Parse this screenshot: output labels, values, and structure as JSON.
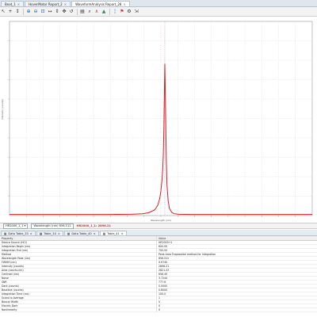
{
  "window_tabs": [
    {
      "label": "Beat_1",
      "active": false
    },
    {
      "label": "HoverMotor Report_2",
      "active": false
    },
    {
      "label": "WaveformAnalysis Report_28",
      "active": true
    }
  ],
  "toolbar_icons": [
    "cursor-icon",
    "crosshair-icon",
    "arrow-icon",
    "zoom-in-icon",
    "zoom-out-icon",
    "zoom-fit-icon",
    "zoom-x-icon",
    "zoom-y-icon",
    "pan-icon",
    "undo-icon",
    "print-icon",
    "find-icon",
    "peak-icon",
    "area-icon",
    "marker-icon",
    "flag-icon",
    "settings-icon",
    "export-icon"
  ],
  "statusbar": {
    "dataset": "HR2000_1_1",
    "readout": "Wavelength (nm) 656.512",
    "highlight": "HR2000_1_1: 2896.21"
  },
  "bottom_tabs": [
    {
      "label": "Data Table_33",
      "active": false
    },
    {
      "label": "Table_34",
      "active": false
    },
    {
      "label": "Data Table_40",
      "active": false
    },
    {
      "label": "Table_41",
      "active": true
    }
  ],
  "table": {
    "headers": [
      "Property",
      "Value"
    ],
    "rows": [
      [
        "Device Source (HCl)",
        "HR2000+1"
      ],
      [
        "Integration Begin (nm)",
        "600.00"
      ],
      [
        "Integration End (nm)",
        "700.00"
      ],
      [
        "Method",
        "Peak Area Trapezoidal method for Integration"
      ],
      [
        "Wavelength Peak (nm)",
        "656.512"
      ],
      [
        "FWHM (nm)",
        "0.9740"
      ],
      [
        "Intensity (counts)",
        "2896.21"
      ],
      [
        "Area (counts.nm)",
        "2821.43"
      ],
      [
        "Centroid (nm)",
        "656.49"
      ],
      [
        "Noise",
        "3.7244"
      ],
      [
        "SNR",
        "777.6"
      ],
      [
        "Dark (counts)",
        "0.0000"
      ],
      [
        "Baseline (counts)",
        "0.8000"
      ],
      [
        "Integration Time (ms)",
        "100.0"
      ],
      [
        "Scans to Average",
        "1"
      ],
      [
        "Boxcar Width",
        "0"
      ],
      [
        "Electric Dark",
        "0"
      ],
      [
        "Nonlinearity",
        "0"
      ]
    ]
  },
  "chart_data": {
    "type": "line",
    "xlabel": "Wavelength (nm)",
    "ylabel": "Intensity (counts)",
    "series": [
      {
        "color": "#d42020",
        "x": [
          400,
          560,
          600,
          620,
          630,
          640,
          645,
          648,
          650,
          652,
          653,
          654,
          655,
          656,
          656.5,
          657,
          658,
          659,
          660,
          662,
          664,
          668,
          672,
          680,
          700,
          750,
          800,
          900
        ],
        "y": [
          20,
          20,
          25,
          35,
          55,
          110,
          200,
          320,
          470,
          700,
          880,
          1150,
          1700,
          2500,
          2896,
          2600,
          1800,
          1050,
          600,
          280,
          140,
          60,
          35,
          25,
          20,
          20,
          20,
          20
        ]
      }
    ],
    "marker_x": 656.5,
    "grid": true
  }
}
